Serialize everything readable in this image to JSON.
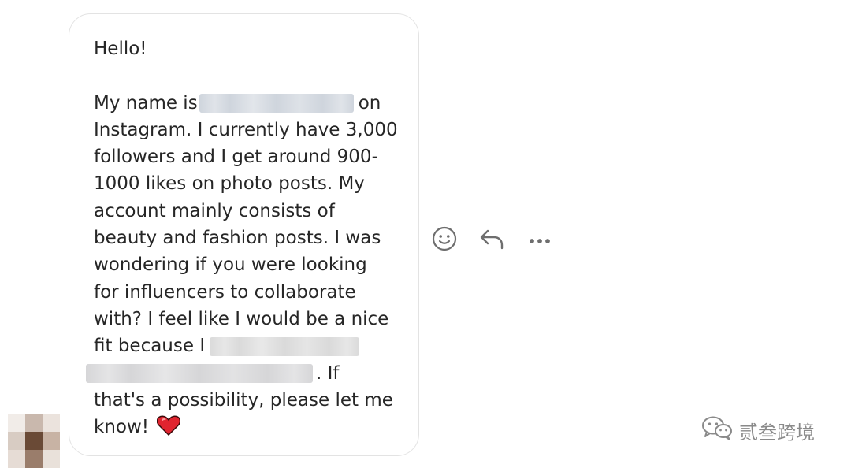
{
  "message": {
    "greeting": "Hello!",
    "l2_a": "My name is",
    "l2_b": "on",
    "l3": "Instagram. I currently have 3,000",
    "l4": "followers and I get around 900-",
    "l5": "1000 likes on photo posts. My",
    "l6": "account mainly consists of",
    "l7": "beauty and fashion posts. I was",
    "l8": "wondering if you were looking",
    "l9": "for influencers to collaborate",
    "l10": "with? I feel like I would be a nice",
    "l11": "fit because I",
    "l12": ". If",
    "l13": "that's a possibility, please let me",
    "l14": "know!"
  },
  "actions": {
    "react_icon": "smiley-icon",
    "reply_icon": "reply-arrow-icon",
    "more_icon": "more-dots-icon"
  },
  "watermark": {
    "text": "贰叁跨境",
    "icon": "wechat-icon"
  },
  "colors": {
    "text": "#262626",
    "icon": "#6e6e6e",
    "bubble_border": "#e3e3e3",
    "heart": "#e0242f"
  }
}
